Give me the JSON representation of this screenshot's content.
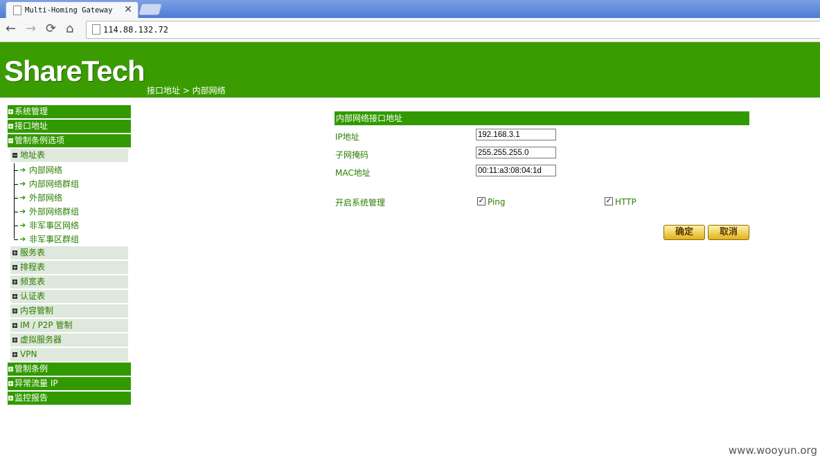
{
  "browser": {
    "tab_title": "Multi-Homing Gateway",
    "tab_close": "✕",
    "url": "114.88.132.72",
    "back": "←",
    "forward": "→",
    "reload": "⟳",
    "home": "⌂"
  },
  "header": {
    "logo": "ShareTech",
    "breadcrumb": "接口地址 > 内部网络"
  },
  "sidebar": {
    "top_items": [
      {
        "label": "系统管理",
        "marker": "+"
      },
      {
        "label": "接口地址",
        "marker": "+"
      },
      {
        "label": "管制条例选项",
        "marker": "−"
      }
    ],
    "address_table": {
      "label": "地址表",
      "marker": "−"
    },
    "address_leaves": [
      "内部网络",
      "内部网络群组",
      "外部网络",
      "外部网络群组",
      "非军事区网络",
      "非军事区群组"
    ],
    "sub_items": [
      {
        "label": "服务表",
        "marker": "+"
      },
      {
        "label": "排程表",
        "marker": "+"
      },
      {
        "label": "频宽表",
        "marker": "+"
      },
      {
        "label": "认证表",
        "marker": "+"
      },
      {
        "label": "内容管制",
        "marker": "+"
      },
      {
        "label": "IM / P2P 管制",
        "marker": "+"
      },
      {
        "label": "虚拟服务器",
        "marker": "+"
      },
      {
        "label": "VPN",
        "marker": "+"
      }
    ],
    "bottom_items": [
      {
        "label": "管制条例",
        "marker": "+"
      },
      {
        "label": "异常流量 IP",
        "marker": "+"
      },
      {
        "label": "监控报告",
        "marker": "+"
      }
    ]
  },
  "form": {
    "title": "内部网络接口地址",
    "ip_label": "IP地址",
    "ip_value": "192.168.3.1",
    "mask_label": "子网掩码",
    "mask_value": "255.255.255.0",
    "mac_label": "MAC地址",
    "mac_value": "00:11:a3:08:04:1d",
    "mgmt_label": "开启系统管理",
    "ping_label": "Ping",
    "ping_checked": true,
    "http_label": "HTTP",
    "http_checked": true,
    "confirm": "确定",
    "cancel": "取消"
  },
  "watermark": "www.wooyun.org"
}
